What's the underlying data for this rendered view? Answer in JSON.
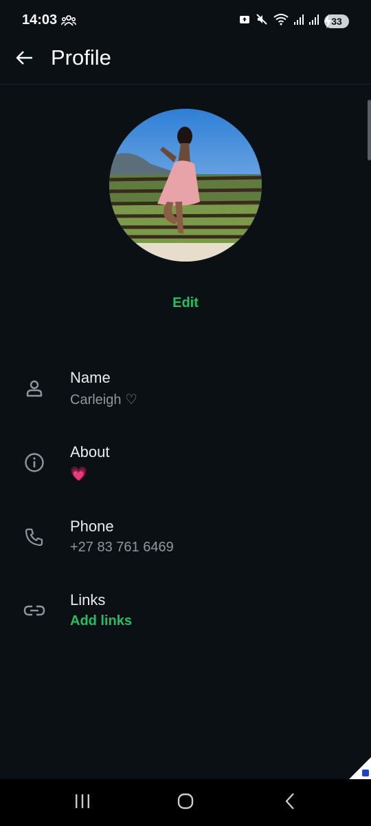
{
  "status": {
    "time": "14:03",
    "battery": "33",
    "icons": [
      "people-icon",
      "upload-icon",
      "mute-icon",
      "wifi-icon",
      "signal-icon",
      "signal-icon",
      "battery-icon"
    ]
  },
  "appbar": {
    "title": "Profile",
    "back_icon": "arrow-left-icon"
  },
  "profile": {
    "avatar": "profile-photo",
    "edit_label": "Edit"
  },
  "rows": [
    {
      "icon": "person-icon",
      "label": "Name",
      "value": "Carleigh ♡"
    },
    {
      "icon": "info-icon",
      "label": "About",
      "value": "💗"
    },
    {
      "icon": "phone-icon",
      "label": "Phone",
      "value": "+27 83 761 6469"
    },
    {
      "icon": "link-icon",
      "label": "Links",
      "value": "Add links"
    }
  ],
  "colors": {
    "background": "#0b1014",
    "accent": "#21c063",
    "secondary_text": "#8f989e"
  },
  "navbar": {
    "icons": [
      "recent-apps-icon",
      "home-icon",
      "back-nav-icon"
    ]
  }
}
